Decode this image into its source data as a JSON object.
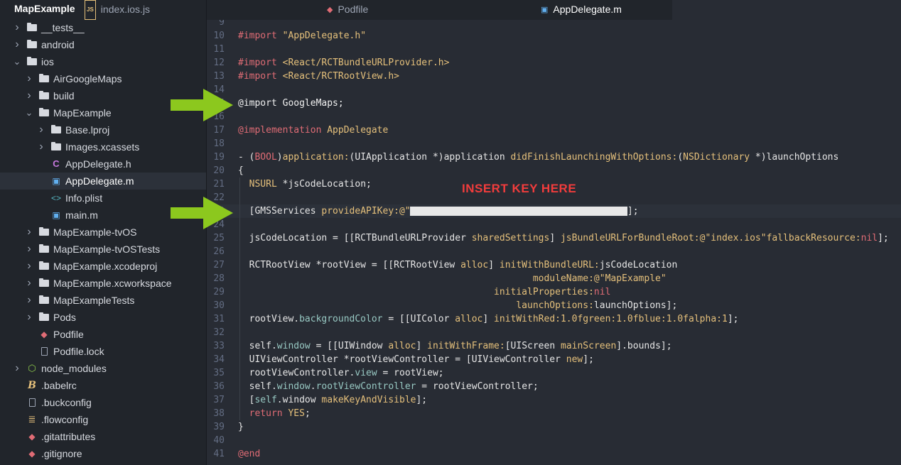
{
  "sidebar": {
    "project_title": "MapExample",
    "items": [
      {
        "label": "__tests__",
        "kind": "folder",
        "depth": 0,
        "expanded": false
      },
      {
        "label": "android",
        "kind": "folder",
        "depth": 0,
        "expanded": false
      },
      {
        "label": "ios",
        "kind": "folder",
        "depth": 0,
        "expanded": true
      },
      {
        "label": "AirGoogleMaps",
        "kind": "folder",
        "depth": 1,
        "expanded": false
      },
      {
        "label": "build",
        "kind": "folder",
        "depth": 1,
        "expanded": false
      },
      {
        "label": "MapExample",
        "kind": "folder",
        "depth": 1,
        "expanded": true
      },
      {
        "label": "Base.lproj",
        "kind": "folder",
        "depth": 2,
        "expanded": false
      },
      {
        "label": "Images.xcassets",
        "kind": "folder",
        "depth": 2,
        "expanded": false
      },
      {
        "label": "AppDelegate.h",
        "kind": "objc-header",
        "depth": 2
      },
      {
        "label": "AppDelegate.m",
        "kind": "objc-file",
        "depth": 2,
        "selected": true
      },
      {
        "label": "Info.plist",
        "kind": "code-file",
        "depth": 2
      },
      {
        "label": "main.m",
        "kind": "objc-file",
        "depth": 2
      },
      {
        "label": "MapExample-tvOS",
        "kind": "folder",
        "depth": 1,
        "expanded": false
      },
      {
        "label": "MapExample-tvOSTests",
        "kind": "folder",
        "depth": 1,
        "expanded": false
      },
      {
        "label": "MapExample.xcodeproj",
        "kind": "folder",
        "depth": 1,
        "expanded": false
      },
      {
        "label": "MapExample.xcworkspace",
        "kind": "folder",
        "depth": 1,
        "expanded": false
      },
      {
        "label": "MapExampleTests",
        "kind": "folder",
        "depth": 1,
        "expanded": false
      },
      {
        "label": "Pods",
        "kind": "folder",
        "depth": 1,
        "expanded": false
      },
      {
        "label": "Podfile",
        "kind": "ruby-file",
        "depth": 1
      },
      {
        "label": "Podfile.lock",
        "kind": "text-file",
        "depth": 1
      },
      {
        "label": "node_modules",
        "kind": "node-folder",
        "depth": 0,
        "expanded": false
      },
      {
        "label": ".babelrc",
        "kind": "babel-file",
        "depth": 0
      },
      {
        "label": ".buckconfig",
        "kind": "text-file",
        "depth": 0
      },
      {
        "label": ".flowconfig",
        "kind": "flow-file",
        "depth": 0
      },
      {
        "label": ".gitattributes",
        "kind": "git-file",
        "depth": 0
      },
      {
        "label": ".gitignore",
        "kind": "git-file",
        "depth": 0
      }
    ]
  },
  "tabs": [
    {
      "label": "index.ios.js",
      "icon": "js-file-icon",
      "icon_text": "JS",
      "active": false
    },
    {
      "label": "Podfile",
      "icon": "ruby-gem-icon",
      "icon_text": "◆",
      "active": false
    },
    {
      "label": "AppDelegate.m",
      "icon": "objc-file-icon",
      "icon_text": "▣",
      "active": true
    }
  ],
  "editor": {
    "note": "INSERT KEY HERE",
    "lines": [
      {
        "n": "9",
        "tokens": []
      },
      {
        "n": "10",
        "tokens": [
          [
            "dir",
            "#import "
          ],
          [
            "str",
            "\"AppDelegate.h\""
          ]
        ]
      },
      {
        "n": "11",
        "tokens": []
      },
      {
        "n": "12",
        "tokens": [
          [
            "dir",
            "#import "
          ],
          [
            "str",
            "<React/RCTBundleURLProvider.h>"
          ]
        ]
      },
      {
        "n": "13",
        "tokens": [
          [
            "dir",
            "#import "
          ],
          [
            "str",
            "<React/RCTRootView.h>"
          ]
        ]
      },
      {
        "n": "14",
        "tokens": []
      },
      {
        "n": "15",
        "tokens": [
          [
            "at",
            "@import GoogleMaps;"
          ]
        ]
      },
      {
        "n": "16",
        "tokens": []
      },
      {
        "n": "17",
        "tokens": [
          [
            "kw",
            "@implementation "
          ],
          [
            "ty",
            "AppDelegate"
          ]
        ]
      },
      {
        "n": "18",
        "tokens": []
      },
      {
        "n": "19",
        "tokens": [
          [
            "",
            "- ("
          ],
          [
            "kw2",
            "BOOL"
          ],
          [
            "",
            ")"
          ],
          [
            "mt",
            "application:"
          ],
          [
            "",
            "(UIApplication *)application "
          ],
          [
            "mt",
            "didFinishLaunchingWithOptions:"
          ],
          [
            "",
            "("
          ],
          [
            "ty",
            "NSDictionary"
          ],
          [
            "",
            " *)launchOptions"
          ]
        ]
      },
      {
        "n": "20",
        "tokens": [
          [
            "",
            "{"
          ]
        ]
      },
      {
        "n": "21",
        "tokens": [
          [
            "",
            "  "
          ],
          [
            "ty",
            "NSURL"
          ],
          [
            "",
            " *jsCodeLocation;"
          ]
        ]
      },
      {
        "n": "22",
        "tokens": []
      },
      {
        "n": "23",
        "tokens": [
          [
            "",
            "  [GMSServices "
          ],
          [
            "mt",
            "provideAPIKey:"
          ],
          [
            "str",
            "@\"                                      \""
          ],
          [
            "",
            "];"
          ]
        ],
        "cursor": true
      },
      {
        "n": "24",
        "tokens": []
      },
      {
        "n": "25",
        "tokens": [
          [
            "",
            "  jsCodeLocation = [[RCTBundleURLProvider "
          ],
          [
            "mt",
            "sharedSettings"
          ],
          [
            "",
            "] "
          ],
          [
            "mt",
            "jsBundleURLForBundleRoot:"
          ],
          [
            "str",
            "@\"index.ios\""
          ],
          [
            " ",
            ""
          ],
          [
            "mt",
            "fallbackResource:"
          ],
          [
            "kw2",
            "nil"
          ],
          [
            "",
            "];"
          ]
        ]
      },
      {
        "n": "26",
        "tokens": []
      },
      {
        "n": "27",
        "tokens": [
          [
            "",
            "  RCTRootView *rootView = [[RCTRootView "
          ],
          [
            "mt",
            "alloc"
          ],
          [
            "",
            "] "
          ],
          [
            "mt",
            "initWithBundleURL:"
          ],
          [
            "",
            "jsCodeLocation"
          ]
        ]
      },
      {
        "n": "28",
        "tokens": [
          [
            "",
            "                                                     "
          ],
          [
            "mt",
            "moduleName:"
          ],
          [
            "str",
            "@\"MapExample\""
          ]
        ]
      },
      {
        "n": "29",
        "tokens": [
          [
            "",
            "                                              "
          ],
          [
            "mt",
            "initialProperties:"
          ],
          [
            "kw2",
            "nil"
          ]
        ]
      },
      {
        "n": "30",
        "tokens": [
          [
            "",
            "                                                  "
          ],
          [
            "mt",
            "launchOptions:"
          ],
          [
            "",
            "launchOptions];"
          ]
        ]
      },
      {
        "n": "31",
        "tokens": [
          [
            "",
            "  rootView."
          ],
          [
            "prop",
            "backgroundColor"
          ],
          [
            "",
            " = [[UIColor "
          ],
          [
            "mt",
            "alloc"
          ],
          [
            "",
            "] "
          ],
          [
            "mt",
            "initWithRed:"
          ],
          [
            "num",
            "1.0f"
          ],
          [
            " ",
            ""
          ],
          [
            "mt",
            "green:"
          ],
          [
            "num",
            "1.0f"
          ],
          [
            " ",
            ""
          ],
          [
            "mt",
            "blue:"
          ],
          [
            "num",
            "1.0f"
          ],
          [
            " ",
            ""
          ],
          [
            "mt",
            "alpha:"
          ],
          [
            "num",
            "1"
          ],
          [
            "",
            "];"
          ]
        ]
      },
      {
        "n": "32",
        "tokens": []
      },
      {
        "n": "33",
        "tokens": [
          [
            "",
            "  self."
          ],
          [
            "prop",
            "window"
          ],
          [
            "",
            " = [[UIWindow "
          ],
          [
            "mt",
            "alloc"
          ],
          [
            "",
            "] "
          ],
          [
            "mt",
            "initWithFrame:"
          ],
          [
            "",
            "[UIScreen "
          ],
          [
            "mt",
            "mainScreen"
          ],
          [
            "",
            "].bounds];"
          ]
        ]
      },
      {
        "n": "34",
        "tokens": [
          [
            "",
            "  UIViewController *rootViewController = [UIViewController "
          ],
          [
            "mt",
            "new"
          ],
          [
            "",
            "];"
          ]
        ]
      },
      {
        "n": "35",
        "tokens": [
          [
            "",
            "  rootViewController."
          ],
          [
            "prop",
            "view"
          ],
          [
            "",
            " = rootView;"
          ]
        ]
      },
      {
        "n": "36",
        "tokens": [
          [
            "",
            "  self."
          ],
          [
            "prop",
            "window"
          ],
          [
            "",
            "."
          ],
          [
            "prop",
            "rootViewController"
          ],
          [
            "",
            " = rootViewController;"
          ]
        ]
      },
      {
        "n": "37",
        "tokens": [
          [
            "",
            "  ["
          ],
          [
            "prop",
            "self"
          ],
          [
            "",
            ".window "
          ],
          [
            "mt",
            "makeKeyAndVisible"
          ],
          [
            "",
            "];"
          ]
        ]
      },
      {
        "n": "38",
        "tokens": [
          [
            "",
            "  "
          ],
          [
            "kw2",
            "return "
          ],
          [
            "ty",
            "YES"
          ],
          [
            "",
            ";"
          ]
        ]
      },
      {
        "n": "39",
        "tokens": [
          [
            "",
            "}"
          ]
        ]
      },
      {
        "n": "40",
        "tokens": []
      },
      {
        "n": "41",
        "tokens": [
          [
            "kw",
            "@end"
          ]
        ]
      }
    ]
  },
  "colors": {
    "arrow": "#8cc81e",
    "note": "#f23c3c",
    "accent_blue": "#61afef"
  }
}
